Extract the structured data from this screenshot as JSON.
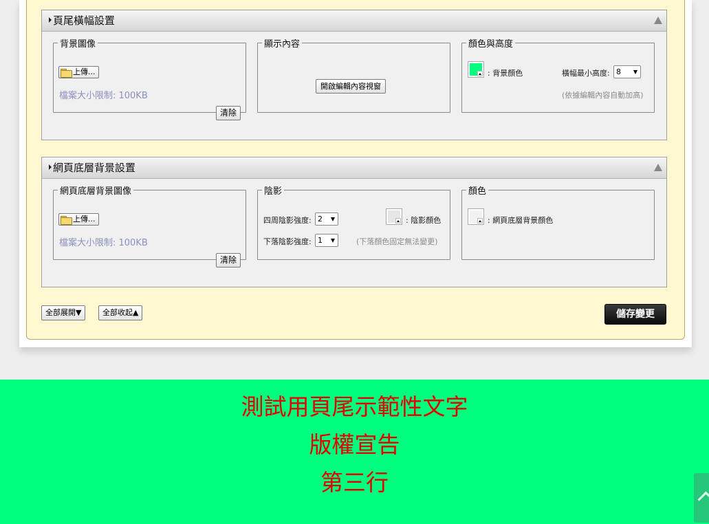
{
  "footer_banner_section": {
    "title": "頁尾橫幅設置",
    "background_image": {
      "legend": "背景圖像",
      "upload_label": "上傳...",
      "size_limit": "檔案大小限制: 100KB",
      "clear_label": "清除"
    },
    "display_content": {
      "legend": "顯示內容",
      "open_editor_label": "開啟編輯內容視窗"
    },
    "color_height": {
      "legend": "顏色與高度",
      "bg_color_label": ": 背景顏色",
      "bg_color": "#00ff7f",
      "min_height_label": "橫幅最小高度:",
      "min_height_value": "8",
      "auto_note": "(依據編輯內容自動加高)"
    }
  },
  "page_bg_section": {
    "title": "網頁底層背景設置",
    "background_image": {
      "legend": "網頁底層背景圖像",
      "upload_label": "上傳...",
      "size_limit": "檔案大小限制: 100KB",
      "clear_label": "清除"
    },
    "shadow": {
      "legend": "陰影",
      "around_label": "四周陰影強度:",
      "around_value": "2",
      "bottom_label": "下落陰影強度:",
      "bottom_value": "1",
      "shadow_color_label": ": 陰影顏色",
      "shadow_color": "#e6e6e6",
      "fixed_note": "(下落顏色固定無法變更)"
    },
    "color": {
      "legend": "顏色",
      "page_bg_color_label": ": 網頁底層背景顏色",
      "page_bg_color": "#f2f2f2"
    }
  },
  "actions": {
    "expand_all": "全部展開▼",
    "collapse_all": "全部收起▲",
    "save": "儲存變更"
  },
  "site_footer": {
    "lines": [
      "測試用頁尾示範性文字",
      "版權宣告",
      "第三行"
    ],
    "text_color": "#e60000",
    "bg_color": "#00ff7f"
  }
}
